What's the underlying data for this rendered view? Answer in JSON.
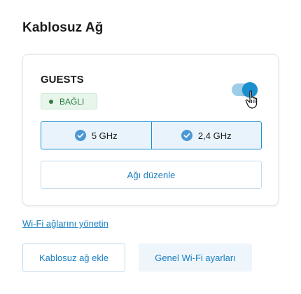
{
  "page": {
    "title": "Kablosuz Ağ"
  },
  "network": {
    "name": "GUESTS",
    "status": "BAĞLI",
    "enabled": true,
    "bands": [
      {
        "label": "5 GHz",
        "selected": true
      },
      {
        "label": "2,4 GHz",
        "selected": true
      }
    ],
    "edit_label": "Ağı düzenle"
  },
  "links": {
    "manage": "Wi-Fi ağlarını yönetin"
  },
  "actions": {
    "add_label": "Kablosuz ağ ekle",
    "settings_label": "Genel Wi-Fi ayarları"
  },
  "colors": {
    "accent": "#1a8fd0",
    "status_green": "#2e7d43",
    "status_bg": "#e7f5ea"
  },
  "icons": {
    "status": "dot-icon",
    "band_check": "check-circle-icon",
    "cursor": "hand-pointer-icon"
  }
}
